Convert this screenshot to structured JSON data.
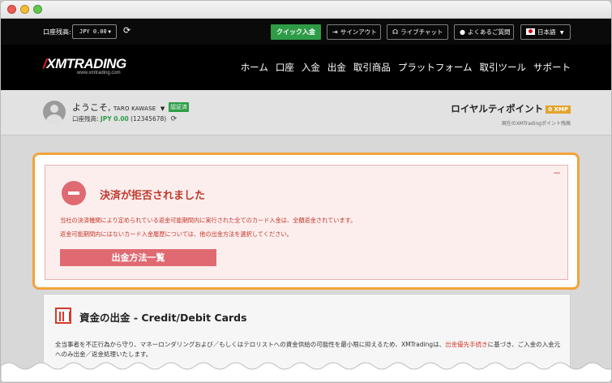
{
  "topbar": {
    "balance_label": "口座残高:",
    "balance_value": "JPY 0.00",
    "quick_deposit": "クイック入金",
    "sign_out": "サインアウト",
    "live_chat": "ライブチャット",
    "faq": "よくあるご質問",
    "language": "日本語"
  },
  "header": {
    "logo_text": "XMTRADING",
    "logo_url": "www.xmtrading.com",
    "nav": [
      "ホーム",
      "口座",
      "入金",
      "出金",
      "取引商品",
      "プラットフォーム",
      "取引ツール",
      "サポート"
    ]
  },
  "account": {
    "welcome": "ようこそ,",
    "user_name": "TARO KAWASE",
    "verified": "認証済",
    "balance_label": "口座残高:",
    "balance_amount": "JPY 0.00",
    "account_number": "(12345678)",
    "loyalty_title": "ロイヤルティポイント",
    "loyalty_points": "0 XMP",
    "loyalty_sub": "現在のXMTradingポイント残高"
  },
  "alert": {
    "collapse": "−",
    "title": "決済が拒否されました",
    "message1": "当社の決済機関により定められている返金可能期間内に実行された全てのカード入金は、全額返金されています。",
    "message2": "返金可能期間内にはないカード入金履歴については、他の出金方法を選択してください。",
    "button": "出金方法一覧"
  },
  "panel": {
    "title": "資金の出金 - Credit/Debit Cards",
    "text_before": "全当事者を不正行為から守り、マネーロンダリングおよび／もしくはテロリストへの資金供給の可能性を最小限に抑えるため、XMTradingは、",
    "text_link": "出金優先手続き",
    "text_after": "に基づき、ご入金の入金元へのみ出金／返金処理いたします。"
  },
  "colors": {
    "accent_green": "#2e9c47",
    "alert_red": "#c0392b",
    "highlight_orange": "#f2a33a",
    "button_pink": "#e06a72"
  }
}
